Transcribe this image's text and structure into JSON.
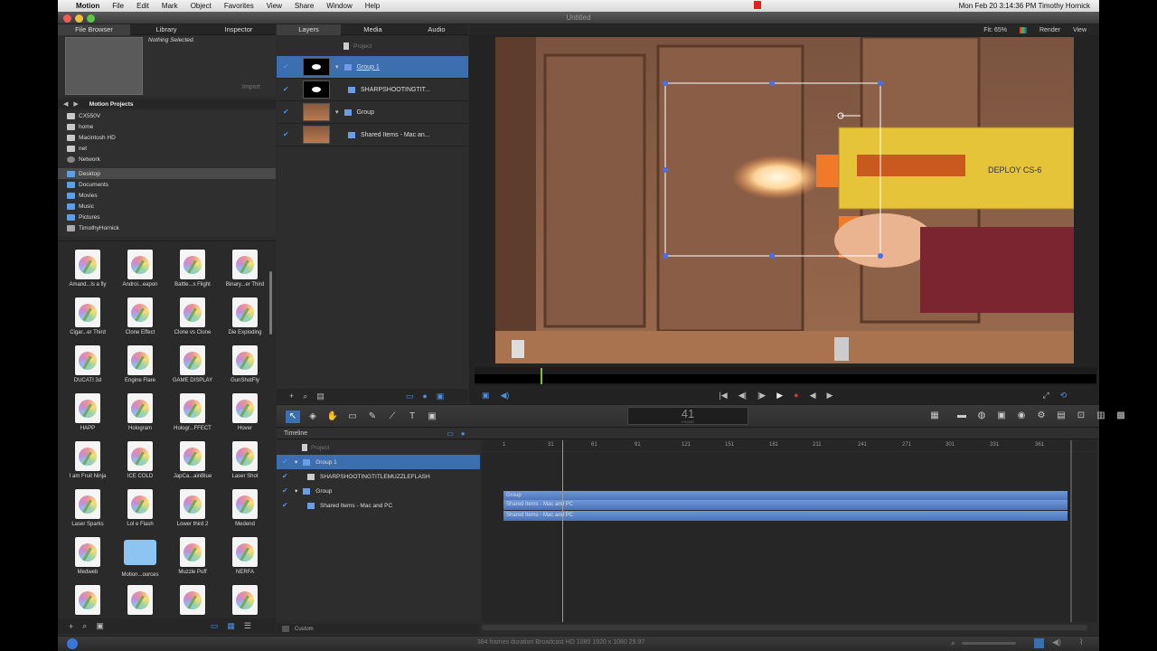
{
  "menubar": {
    "apple": "",
    "app_name": "Motion",
    "items": [
      "File",
      "Edit",
      "Mark",
      "Object",
      "Favorites",
      "View",
      "Share",
      "Window",
      "Help"
    ],
    "status_text": "Mon Feb 20  3:14:36 PM   Timothy Hornick"
  },
  "window": {
    "title": "Untitled"
  },
  "left_panel": {
    "tabs": [
      "File Browser",
      "Library",
      "Inspector"
    ],
    "preview_text": "Nothing Selected.",
    "import_label": "Import",
    "nav_path": "Motion Projects",
    "sources": [
      {
        "label": "CX550V",
        "icon": "drive-icon"
      },
      {
        "label": "home",
        "icon": "drive-icon"
      },
      {
        "label": "Macintosh HD",
        "icon": "drive-icon"
      },
      {
        "label": "net",
        "icon": "drive-icon"
      },
      {
        "label": "Network",
        "icon": "network-icon"
      }
    ],
    "folders": [
      "Desktop",
      "Documents",
      "Movies",
      "Music",
      "Pictures",
      "TimothyHornick"
    ],
    "files": [
      "Amand...ls a fly",
      "Androi...eapon",
      "Battle...s Flight",
      "Binary...er Third",
      "Cigar...er Third",
      "Clone Effect",
      "Clone vs Clone",
      "Die Exploding",
      "DUCATI 3d",
      "Engine Flare",
      "GAME DISPLAY",
      "GunShotFly",
      "HAPP",
      "Hologram",
      "Hologr...FFECT",
      "Hover",
      "I am Fruit Ninja",
      "ICE COLD",
      "JapCa...ainBlue",
      "Laser Shot",
      "Laser Sparks",
      "Lol e Flash",
      "Lower third 2",
      "Medend",
      "Medweb",
      "Motion...ources",
      "Muzzle Puff",
      "NERFA",
      "",
      "",
      "",
      ""
    ]
  },
  "layers_panel": {
    "tabs": [
      "Layers",
      "Media",
      "Audio"
    ],
    "project_label": "Project",
    "rows": [
      "Group 1",
      "SHARPSHOOTINGTIT...",
      "Group",
      "Shared Items - Mac an..."
    ]
  },
  "canvas": {
    "fit_label": "Fit: 65%",
    "render_label": "Render",
    "view_label": "View",
    "gun_text": "DEPLOY CS-6"
  },
  "toolbar": {
    "frame_number": "41",
    "frame_label": "FRAME"
  },
  "timeline": {
    "title": "Timeline",
    "project_label": "Project",
    "rows": [
      "Group 1",
      "SHARPSHOOTINGTITLEMUZZLEFLASH",
      "Group",
      "Shared Items - Mac and PC"
    ],
    "ruler": [
      "1",
      "31",
      "61",
      "91",
      "121",
      "151",
      "181",
      "211",
      "241",
      "271",
      "301",
      "331",
      "361"
    ],
    "bars": [
      "Group",
      "Shared Items - Mac and PC",
      "Shared Items - Mac and PC"
    ],
    "custom_label": "Custom"
  },
  "status_bar": {
    "text": "384 frames duration  Broadcast HD 1080 1920 x 1080 29.97"
  },
  "colors": {
    "accent": "#4a90e2",
    "selection": "#3d6fb0",
    "bar": "#5b86cc"
  }
}
